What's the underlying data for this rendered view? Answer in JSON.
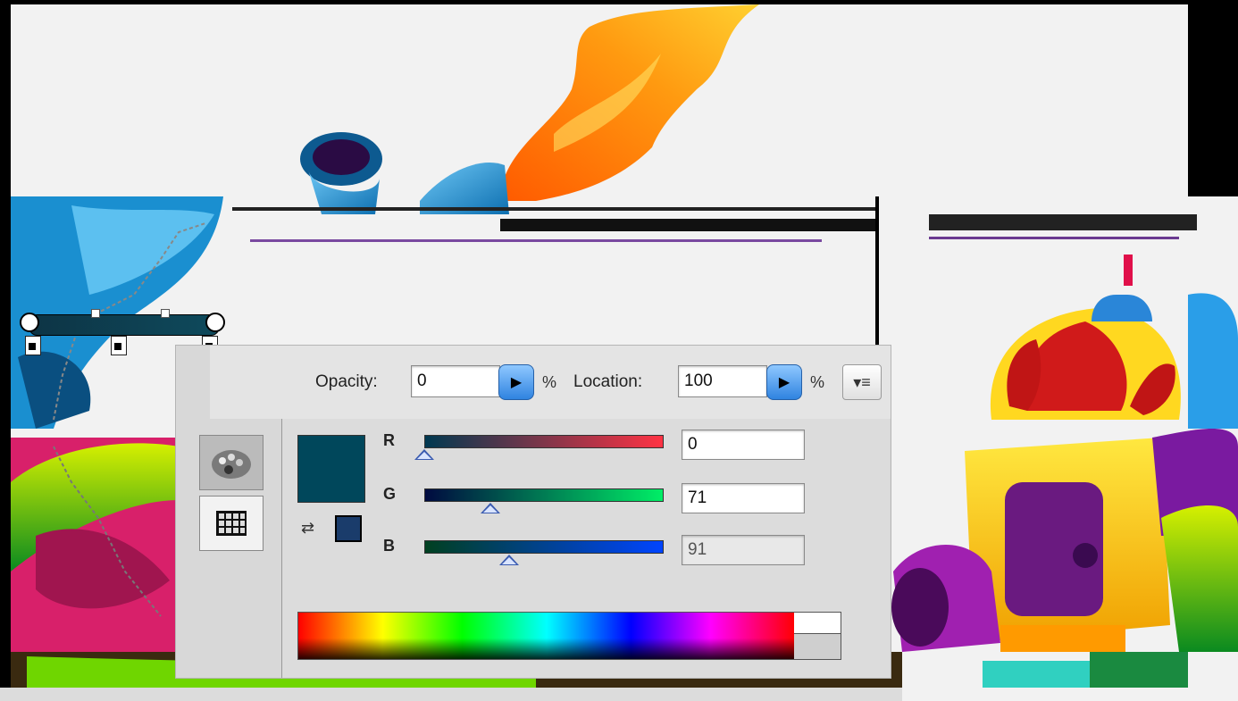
{
  "panel": {
    "opacity_label": "Opacity:",
    "opacity_value": "0",
    "opacity_unit": "%",
    "location_label": "Location:",
    "location_value": "100",
    "location_unit": "%",
    "menu_glyph": "▾≡"
  },
  "channels": [
    {
      "label": "R",
      "value": "0",
      "fraction": 0.0
    },
    {
      "label": "G",
      "value": "71",
      "fraction": 0.278
    },
    {
      "label": "B",
      "value": "91",
      "fraction": 0.357
    }
  ],
  "colors": {
    "selected": "#00475b",
    "slider_r_end": "#ff3344",
    "slider_g_end": "#00ee66",
    "slider_b_end": "#0044ff",
    "accent_button": "#2f83e0"
  },
  "icons": {
    "color_mixer": "color-mixer-icon",
    "swatches": "swatches-grid-icon",
    "swap": "swap-colors-icon",
    "menu": "panel-menu-icon",
    "arrow": "slider-popup-arrow-icon"
  }
}
